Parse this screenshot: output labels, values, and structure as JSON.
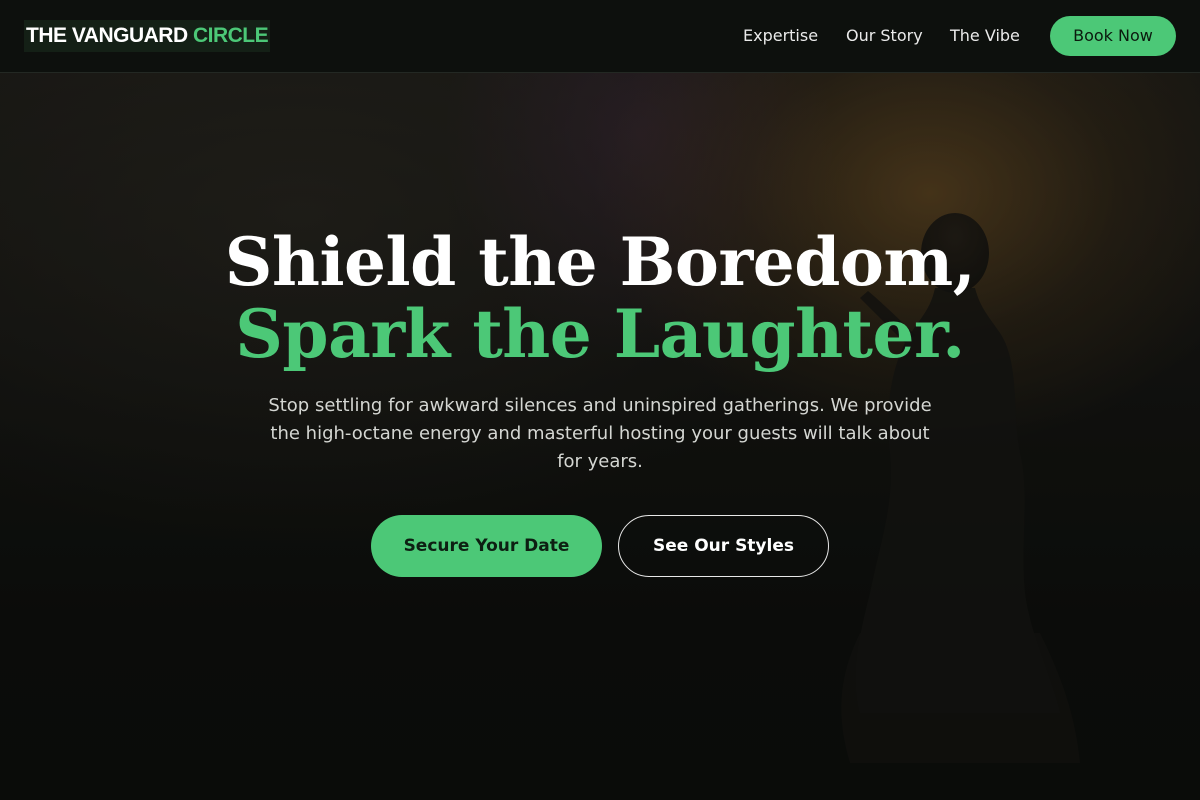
{
  "header": {
    "logo": {
      "part1": "THE VANGUARD",
      "part2": "CIRCLE"
    },
    "nav": [
      {
        "label": "Expertise"
      },
      {
        "label": "Our Story"
      },
      {
        "label": "The Vibe"
      }
    ],
    "cta_label": "Book Now"
  },
  "hero": {
    "title_line1": "Shield the Boredom,",
    "title_line2": "Spark the Laughter.",
    "subtitle": "Stop settling for awkward silences and uninspired gatherings. We provide the high-octane energy and masterful hosting your guests will talk about for years.",
    "primary_button": "Secure Your Date",
    "secondary_button": "See Our Styles"
  },
  "colors": {
    "accent": "#4cc877",
    "background": "#0b0e0b",
    "text": "#ffffff"
  }
}
